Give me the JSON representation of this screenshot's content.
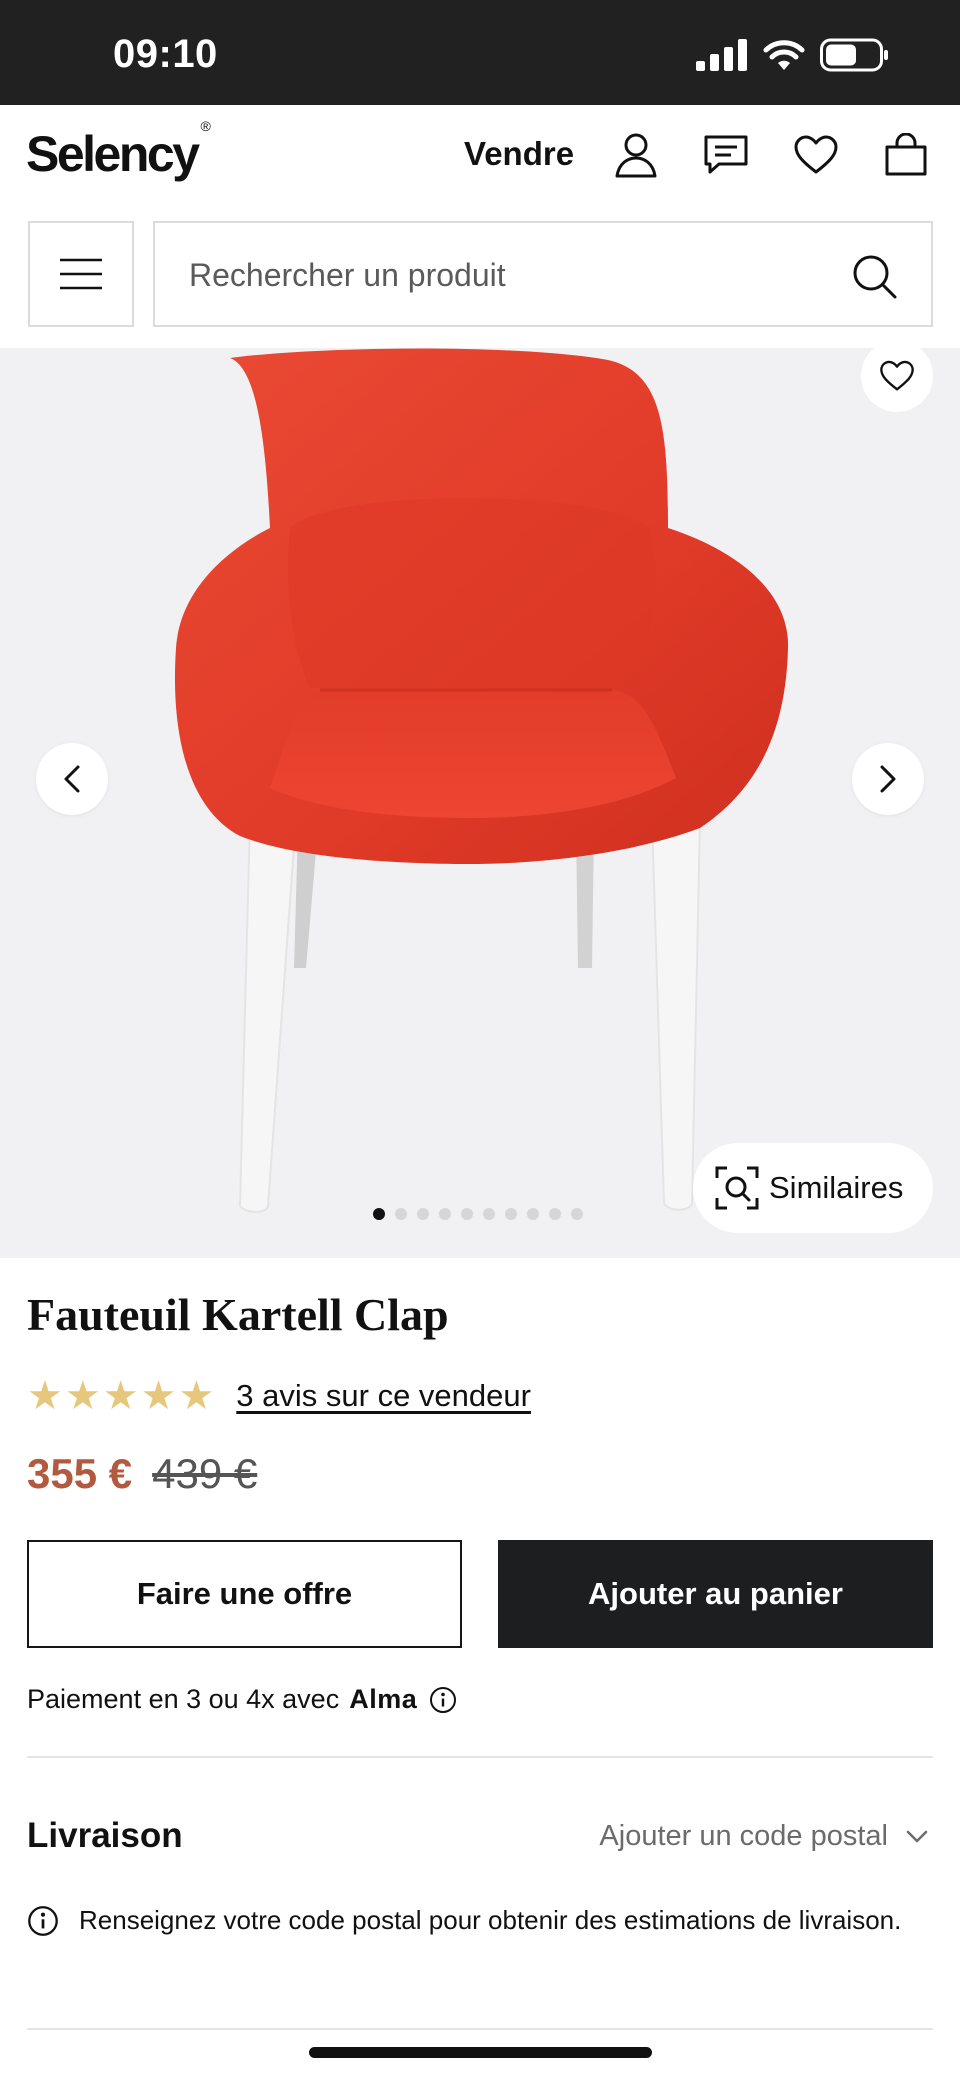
{
  "status_bar": {
    "time": "09:10"
  },
  "header": {
    "logo": "Selency",
    "logo_mark": "®",
    "sell_label": "Vendre"
  },
  "search": {
    "placeholder": "Rechercher un produit"
  },
  "gallery": {
    "similar_label": "Similaires",
    "total_images": 10,
    "active_image": 1
  },
  "product": {
    "title": "Fauteuil Kartell Clap",
    "rating_stars": 5,
    "reviews_label": "3 avis sur ce vendeur",
    "price": "355 €",
    "old_price": "439 €",
    "offer_button": "Faire une offre",
    "cart_button": "Ajouter au panier",
    "payment_text": "Paiement en 3 ou 4x avec",
    "payment_brand": "Alma"
  },
  "delivery": {
    "title": "Livraison",
    "postal_link": "Ajouter un code postal",
    "note": "Renseignez votre code postal pour obtenir des estimations de livraison."
  },
  "colors": {
    "accent_price": "#b25a40",
    "star": "#e7c77c",
    "chair_red": "#e23a28",
    "dark_button": "#1c1e20"
  }
}
